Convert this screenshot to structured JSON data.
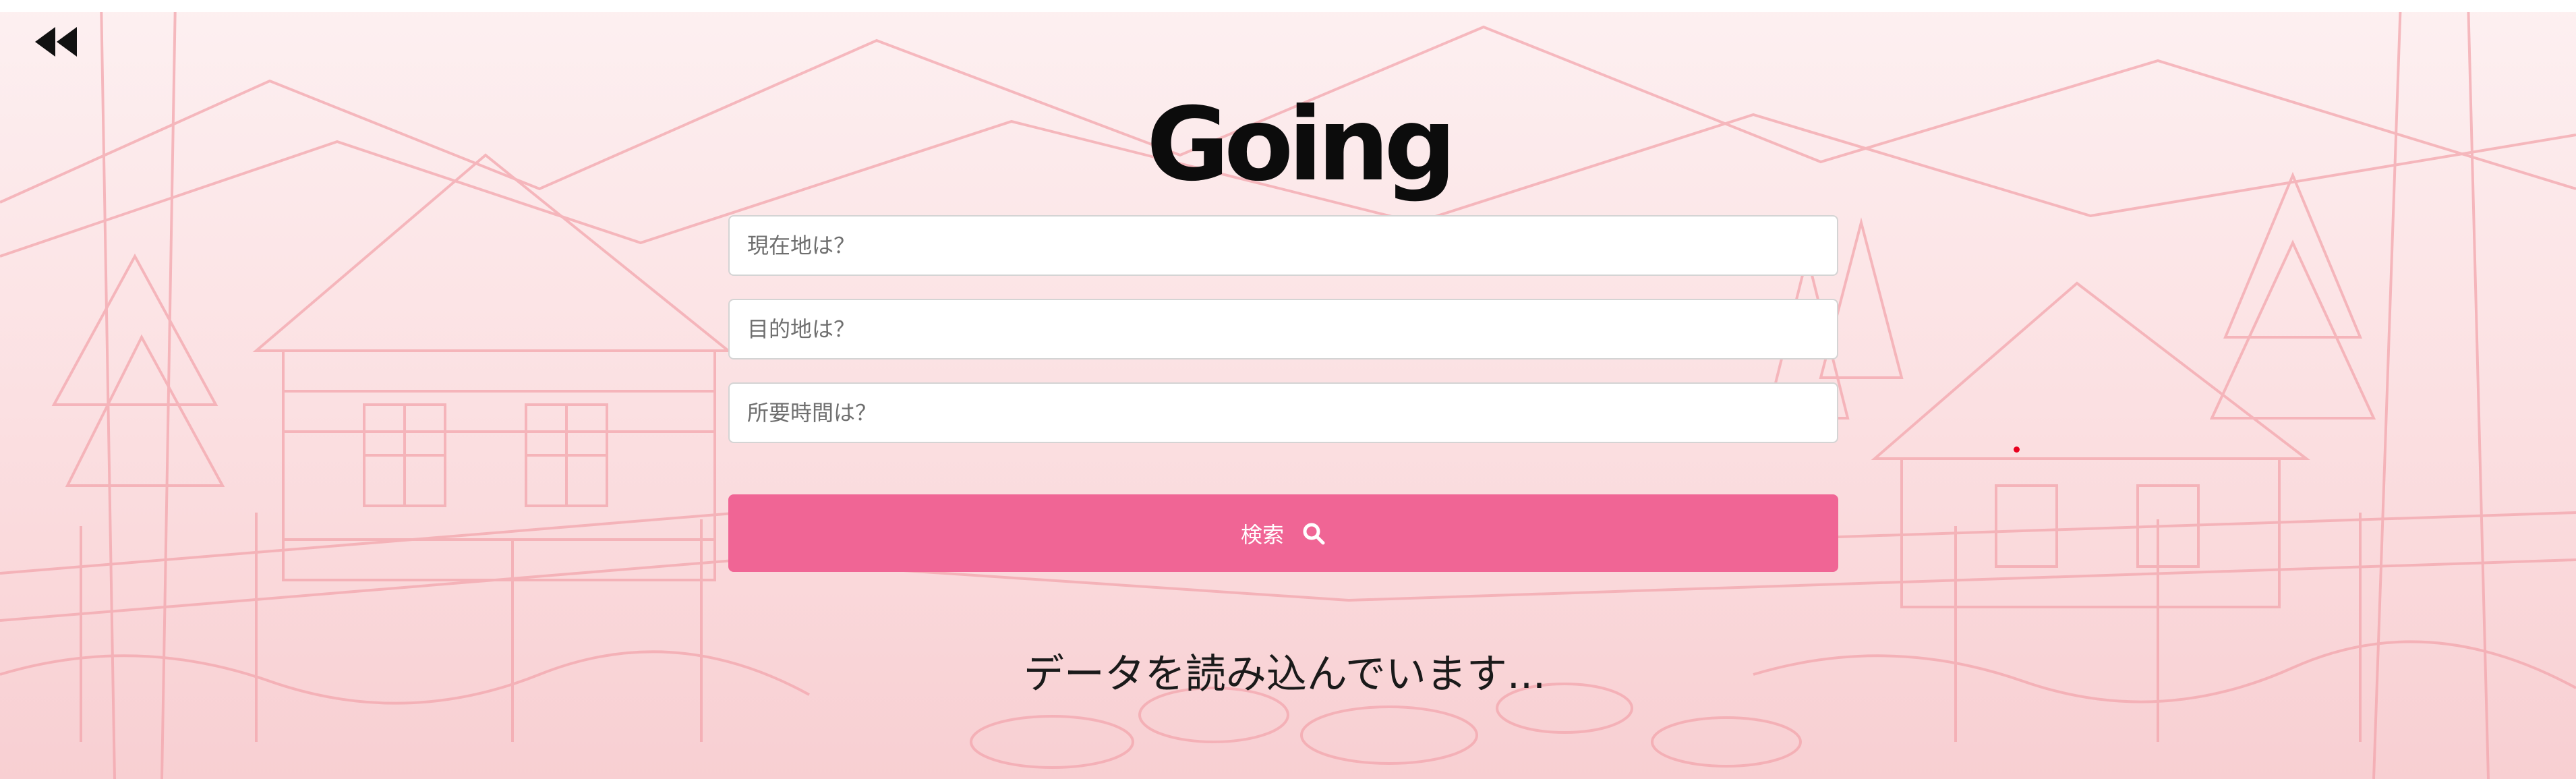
{
  "app": {
    "logo_text": "Going"
  },
  "nav": {
    "back_icon": "double-chevron-left-icon"
  },
  "form": {
    "origin": {
      "placeholder": "現在地は？",
      "value": ""
    },
    "destination": {
      "placeholder": "目的地は？",
      "value": ""
    },
    "duration": {
      "placeholder": "所要時間は？",
      "value": ""
    },
    "search_label": "検索",
    "search_icon": "search-icon"
  },
  "status": {
    "loading_text": "データを読み込んでいます..."
  },
  "colors": {
    "accent": "#f06595",
    "background_tint": "#fbdfe1",
    "illustration_line": "#f3a6ad",
    "status_dot": "#e8001f"
  }
}
